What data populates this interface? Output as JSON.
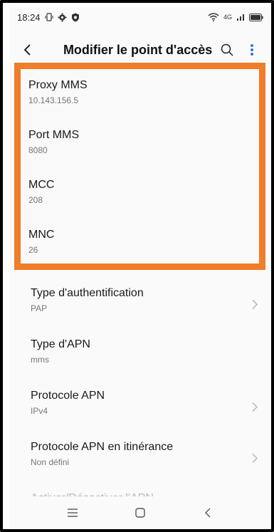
{
  "status_bar": {
    "time": "18:24",
    "network": "4G"
  },
  "header": {
    "title": "Modifier le point d'accès"
  },
  "highlighted_items": [
    {
      "label": "Proxy MMS",
      "value": "10.143.156.5"
    },
    {
      "label": "Port MMS",
      "value": "8080"
    },
    {
      "label": "MCC",
      "value": "208"
    },
    {
      "label": "MNC",
      "value": "26"
    }
  ],
  "items": [
    {
      "label": "Type d'authentification",
      "value": "PAP"
    },
    {
      "label": "Type d'APN",
      "value": "mms"
    },
    {
      "label": "Protocole APN",
      "value": "IPv4"
    },
    {
      "label": "Protocole APN en itinérance",
      "value": "Non défini"
    }
  ],
  "toggle_item": {
    "label": "Activer/Désactiver l'APN",
    "on": true
  },
  "colors": {
    "highlight_border": "#ef7d2a",
    "toggle_on": "#2f74e6",
    "accent_icon": "#2f74e6"
  }
}
